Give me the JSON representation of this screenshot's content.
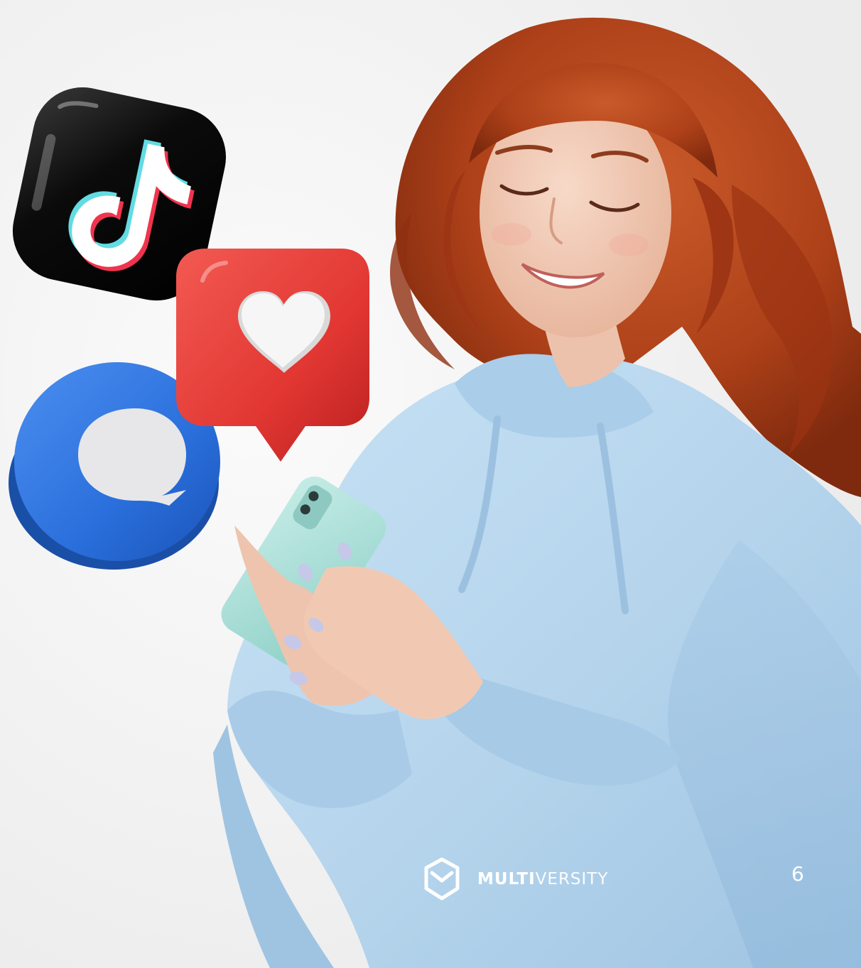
{
  "slide": {
    "background_color": "#f4f4f4",
    "page_number": "6"
  },
  "brand": {
    "name_bold": "MULTI",
    "name_light": "VERSITY",
    "logo_icon": "multiversity-hexagon-logo"
  },
  "illustration": {
    "icons": [
      "tiktok-icon",
      "heart-like-icon",
      "chat-bubble-icon"
    ],
    "colors": {
      "tiktok_tile": "#111111",
      "tiktok_cyan": "#63dbe3",
      "tiktok_red": "#f0344f",
      "like_tile": "#e83a3a",
      "chat_disc": "#2d74dc",
      "hoodie": "#b7d6ee",
      "hair": "#b8481f",
      "phone_case": "#a9dfd9"
    }
  }
}
